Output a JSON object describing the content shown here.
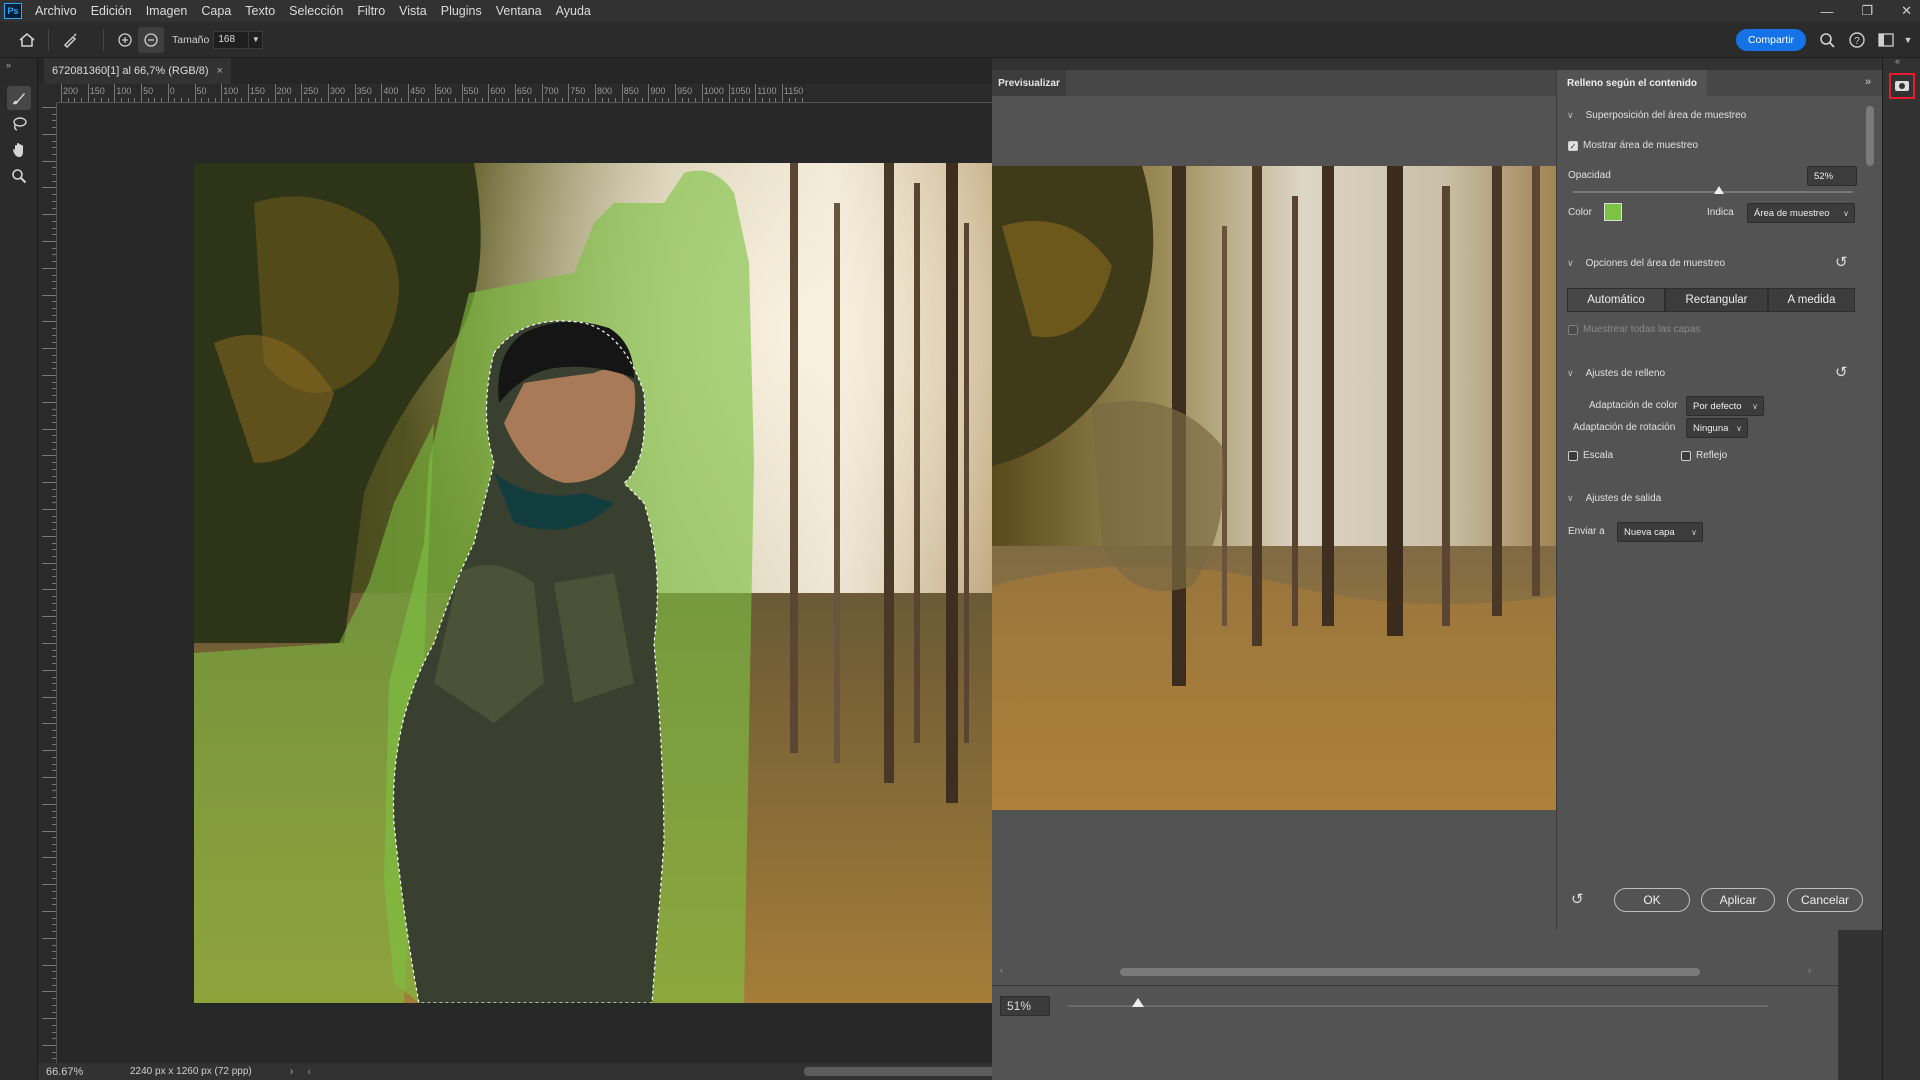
{
  "menubar": {
    "app_icon": "Ps",
    "items": [
      "Archivo",
      "Edición",
      "Imagen",
      "Capa",
      "Texto",
      "Selección",
      "Filtro",
      "Vista",
      "Plugins",
      "Ventana",
      "Ayuda"
    ],
    "window_controls": [
      "—",
      "❐",
      "✕"
    ]
  },
  "options": {
    "size_label": "Tamaño",
    "size_value": "168",
    "share_label": "Compartir"
  },
  "document": {
    "tab_title": "672081360[1] al 66,7% (RGB/8)",
    "tab_close": "×",
    "zoom": "66.67%",
    "dimensions": "2240 px x 1260 px (72 ppp)",
    "ruler_top": [
      "200",
      "150",
      "100",
      "50",
      "0",
      "50",
      "100",
      "150",
      "200",
      "250",
      "300",
      "350",
      "400",
      "450",
      "500",
      "550",
      "600",
      "650",
      "700",
      "750",
      "800",
      "850",
      "900",
      "950",
      "1000",
      "1050",
      "1100",
      "1150"
    ]
  },
  "preview": {
    "tab_label": "Previsualizar",
    "zoom_value": "51%",
    "zoom_fraction": 0.1
  },
  "fill_panel": {
    "tab_label": "Relleno según el contenido",
    "section_overlay": "Superposición del área de muestreo",
    "show_sampling_area": "Mostrar área de muestreo",
    "show_sampling_checked": true,
    "opacity_label": "Opacidad",
    "opacity_value": "52%",
    "opacity_fraction": 0.52,
    "color_label": "Color",
    "color_swatch": "#7dc242",
    "indicates_label": "Indica",
    "indicates_value": "Área de muestreo",
    "section_sampling": "Opciones del área de muestreo",
    "sampling_modes": [
      "Automático",
      "Rectangular",
      "A medida"
    ],
    "sample_all_layers": "Muestrear todas las capas",
    "section_fill": "Ajustes de relleno",
    "color_adapt_label": "Adaptación de color",
    "color_adapt_value": "Por defecto",
    "rotation_adapt_label": "Adaptación de rotación",
    "rotation_adapt_value": "Ninguna",
    "scale_label": "Escala",
    "mirror_label": "Reflejo",
    "section_output": "Ajustes de salida",
    "output_label": "Enviar a",
    "output_value": "Nueva capa",
    "ok_label": "OK",
    "apply_label": "Aplicar",
    "cancel_label": "Cancelar"
  },
  "colors": {
    "accent": "#1473e6",
    "sampling_overlay": "#7dc242",
    "highlight_box": "#e81c2a"
  }
}
